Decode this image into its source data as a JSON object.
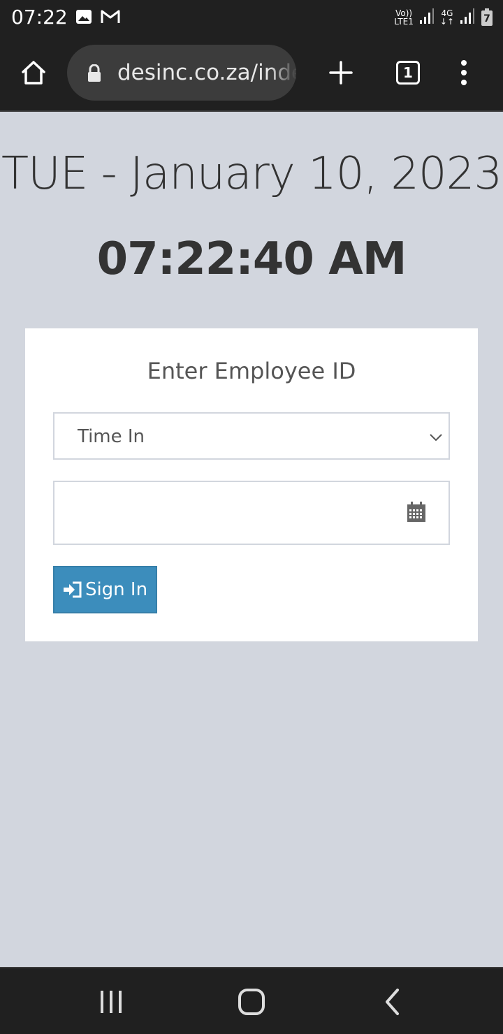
{
  "status_bar": {
    "time": "07:22",
    "net1_top": "Vo))",
    "net1_bottom": "LTE1",
    "net2_top": "4G",
    "battery": "7"
  },
  "browser": {
    "url": "desinc.co.za/index.php",
    "tab_count": "1"
  },
  "page": {
    "date": "TUE - January 10, 2023",
    "time": "07:22:40 AM",
    "form_title": "Enter Employee ID",
    "mode_select": {
      "selected": "Time In"
    },
    "employee_id": {
      "value": "",
      "placeholder": ""
    },
    "signin_label": "Sign In"
  },
  "colors": {
    "page_bg": "#d2d6de",
    "button_primary": "#3c8dbc",
    "system_bar": "#202020"
  }
}
